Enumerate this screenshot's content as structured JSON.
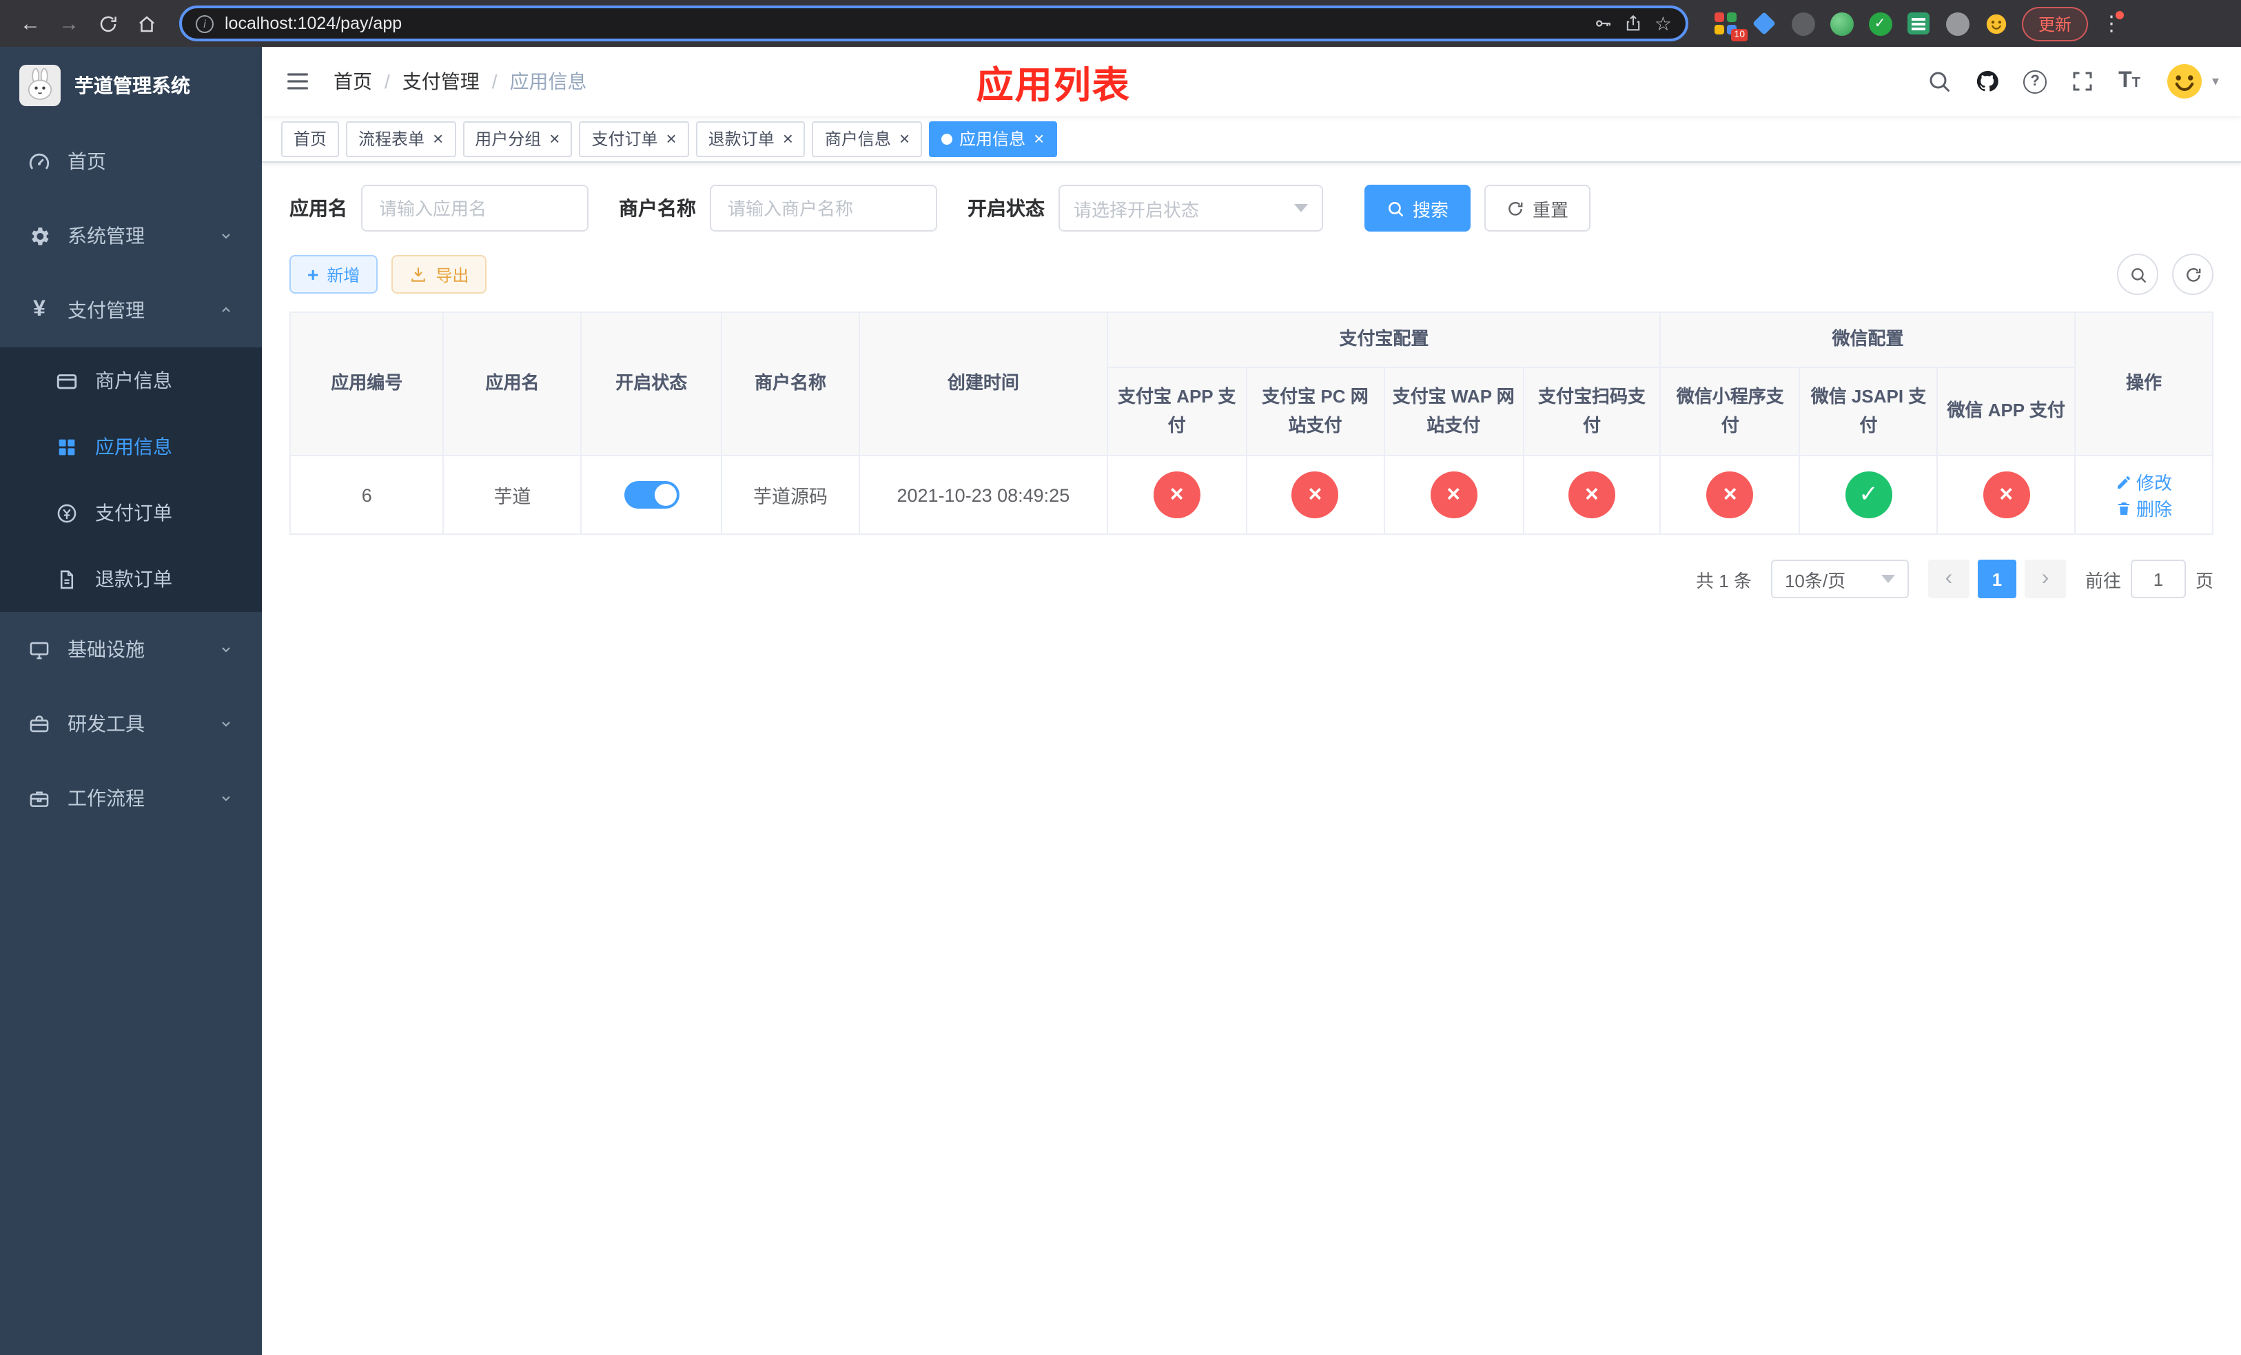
{
  "colors": {
    "accent": "#409eff",
    "danger": "#f85b5b",
    "success": "#1ec36e",
    "warning": "#e6a23c",
    "title_red": "#fe2c20",
    "sidebar_bg": "#304156",
    "submenu_bg": "#1f2d3d"
  },
  "icons": {
    "back": "←",
    "forward": "→",
    "info": "i",
    "star": "☆",
    "kebab": "⋮",
    "close": "×",
    "success": "✓",
    "fail": "×",
    "yen": "¥",
    "plus": "+",
    "question": "?",
    "font_big": "T",
    "font_small": "T",
    "prev": "‹",
    "next": "›",
    "caret_down": "▾"
  },
  "browser": {
    "url": "localhost:1024/pay/app",
    "extensions_badge": "10",
    "update_label": "更新"
  },
  "sidebar": {
    "app_title": "芋道管理系统",
    "items": [
      {
        "label": "首页"
      },
      {
        "label": "系统管理"
      },
      {
        "label": "支付管理"
      },
      {
        "label": "基础设施"
      },
      {
        "label": "研发工具"
      },
      {
        "label": "工作流程"
      }
    ],
    "payment_children": [
      {
        "label": "商户信息"
      },
      {
        "label": "应用信息",
        "active": true
      },
      {
        "label": "支付订单"
      },
      {
        "label": "退款订单"
      }
    ]
  },
  "header": {
    "breadcrumb": [
      {
        "label": "首页"
      },
      {
        "label": "支付管理"
      },
      {
        "label": "应用信息"
      }
    ],
    "page_title": "应用列表"
  },
  "tabs": [
    {
      "label": "首页",
      "closable": false,
      "active": false
    },
    {
      "label": "流程表单",
      "closable": true,
      "active": false
    },
    {
      "label": "用户分组",
      "closable": true,
      "active": false
    },
    {
      "label": "支付订单",
      "closable": true,
      "active": false
    },
    {
      "label": "退款订单",
      "closable": true,
      "active": false
    },
    {
      "label": "商户信息",
      "closable": true,
      "active": false
    },
    {
      "label": "应用信息",
      "closable": true,
      "active": true
    }
  ],
  "filters": {
    "app_name_label": "应用名",
    "app_name_placeholder": "请输入应用名",
    "merchant_label": "商户名称",
    "merchant_placeholder": "请输入商户名称",
    "status_label": "开启状态",
    "status_placeholder": "请选择开启状态",
    "search_label": "搜索",
    "reset_label": "重置"
  },
  "toolbar": {
    "add_label": "新增",
    "export_label": "导出"
  },
  "table": {
    "columns": {
      "app_id": "应用编号",
      "app_name": "应用名",
      "status": "开启状态",
      "merchant": "商户名称",
      "created": "创建时间",
      "alipay_group": "支付宝配置",
      "wechat_group": "微信配置",
      "ops": "操作",
      "alipay_cols": [
        "支付宝 APP 支付",
        "支付宝 PC 网站支付",
        "支付宝 WAP 网站支付",
        "支付宝扫码支付"
      ],
      "wechat_cols": [
        "微信小程序支付",
        "微信 JSAPI 支付",
        "微信 APP 支付"
      ]
    },
    "rows": [
      {
        "app_id": "6",
        "app_name": "芋道",
        "status_on": true,
        "merchant": "芋道源码",
        "created": "2021-10-23 08:49:25",
        "alipay": [
          "no",
          "no",
          "no",
          "no"
        ],
        "wechat": [
          "no",
          "yes",
          "no"
        ],
        "edit_label": "修改",
        "delete_label": "删除"
      }
    ]
  },
  "pagination": {
    "total_text": "共 1 条",
    "page_size": "10条/页",
    "current_page": "1",
    "goto_label": "前往",
    "goto_value": "1",
    "page_unit": "页"
  }
}
